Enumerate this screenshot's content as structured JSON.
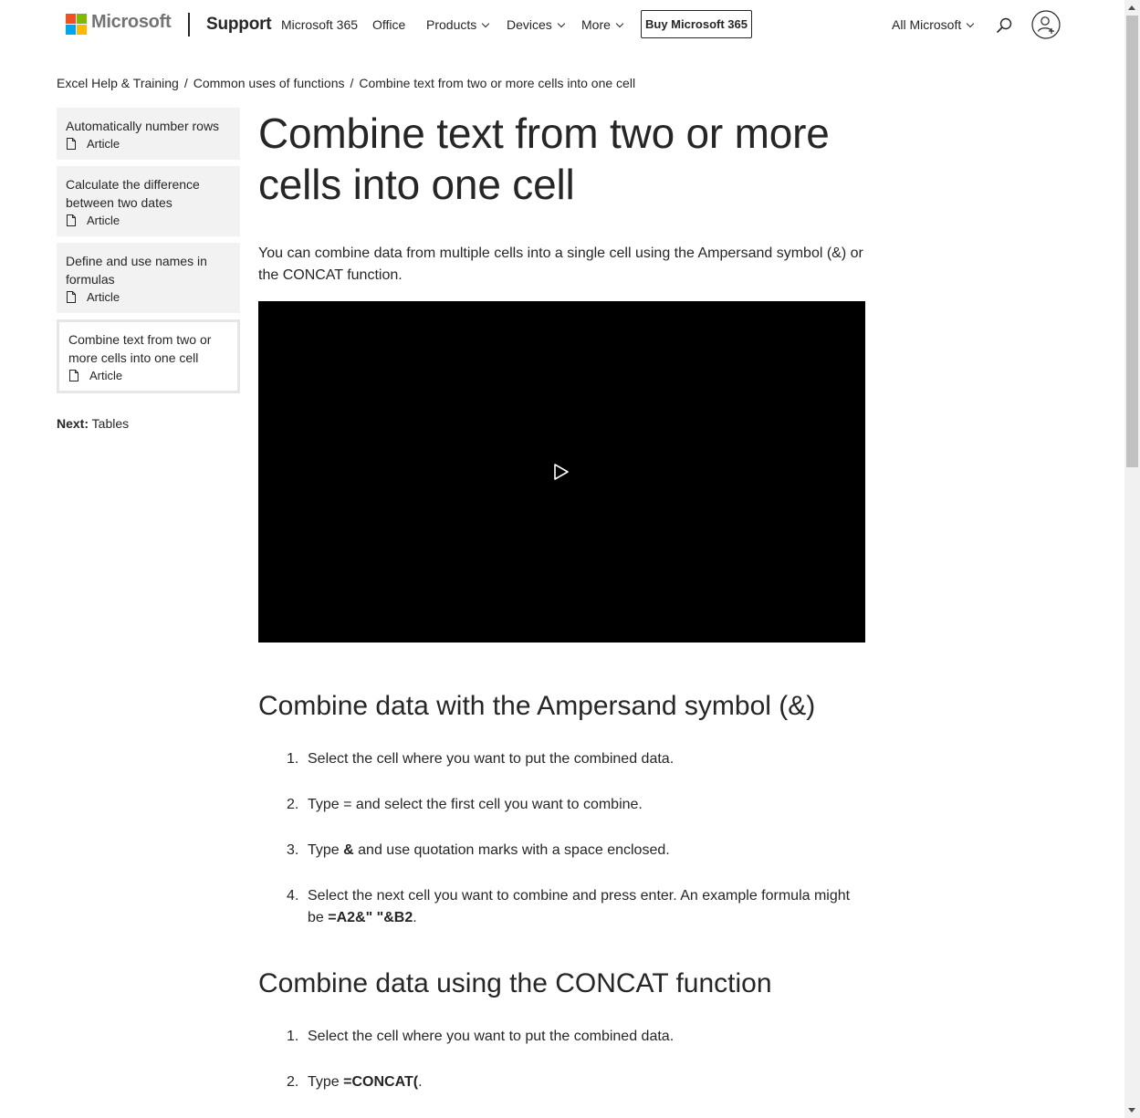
{
  "header": {
    "brand": "Microsoft",
    "support": "Support",
    "nav": {
      "microsoft365": "Microsoft 365",
      "office": "Office",
      "products": "Products",
      "devices": "Devices",
      "more": "More"
    },
    "buy_button": "Buy Microsoft 365",
    "all_microsoft": "All Microsoft",
    "logo_colors": [
      "#f25022",
      "#7fba00",
      "#00a4ef",
      "#ffb900"
    ]
  },
  "breadcrumb": {
    "items": [
      "Excel Help & Training",
      "Common uses of functions",
      "Combine text from two or more cells into one cell"
    ],
    "separator": "/"
  },
  "sidebar": {
    "items": [
      {
        "title": "Automatically number rows",
        "type": "Article"
      },
      {
        "title": "Calculate the difference between two dates",
        "type": "Article"
      },
      {
        "title": "Define and use names in formulas",
        "type": "Article"
      },
      {
        "title": "Combine text from two or more cells into one cell",
        "type": "Article",
        "active": true
      }
    ],
    "next_label": "Next:",
    "next_value": "Tables"
  },
  "article": {
    "title": "Combine text from two or more cells into one cell",
    "intro": "You can combine data from multiple cells into a single cell using the Ampersand symbol (&) or the CONCAT function.",
    "sections": [
      {
        "heading": "Combine data with the Ampersand symbol (&)",
        "steps": [
          {
            "num": "1.",
            "text": "Select the cell where you want to put the combined data."
          },
          {
            "num": "2.",
            "text": "Type = and select the first cell you want to combine."
          },
          {
            "num": "3.",
            "pre": "Type ",
            "bold": "&",
            "post": " and use quotation marks with a space enclosed."
          },
          {
            "num": "4.",
            "pre": "Select the next cell you want to combine and press enter. An example formula might be ",
            "bold": "=A2&\" \"&B2",
            "post": "."
          }
        ]
      },
      {
        "heading": "Combine data using the CONCAT function",
        "steps": [
          {
            "num": "1.",
            "text": "Select the cell where you want to put the combined data."
          },
          {
            "num": "2.",
            "pre": "Type ",
            "bold": "=CONCAT(",
            "post": "."
          }
        ]
      }
    ]
  }
}
